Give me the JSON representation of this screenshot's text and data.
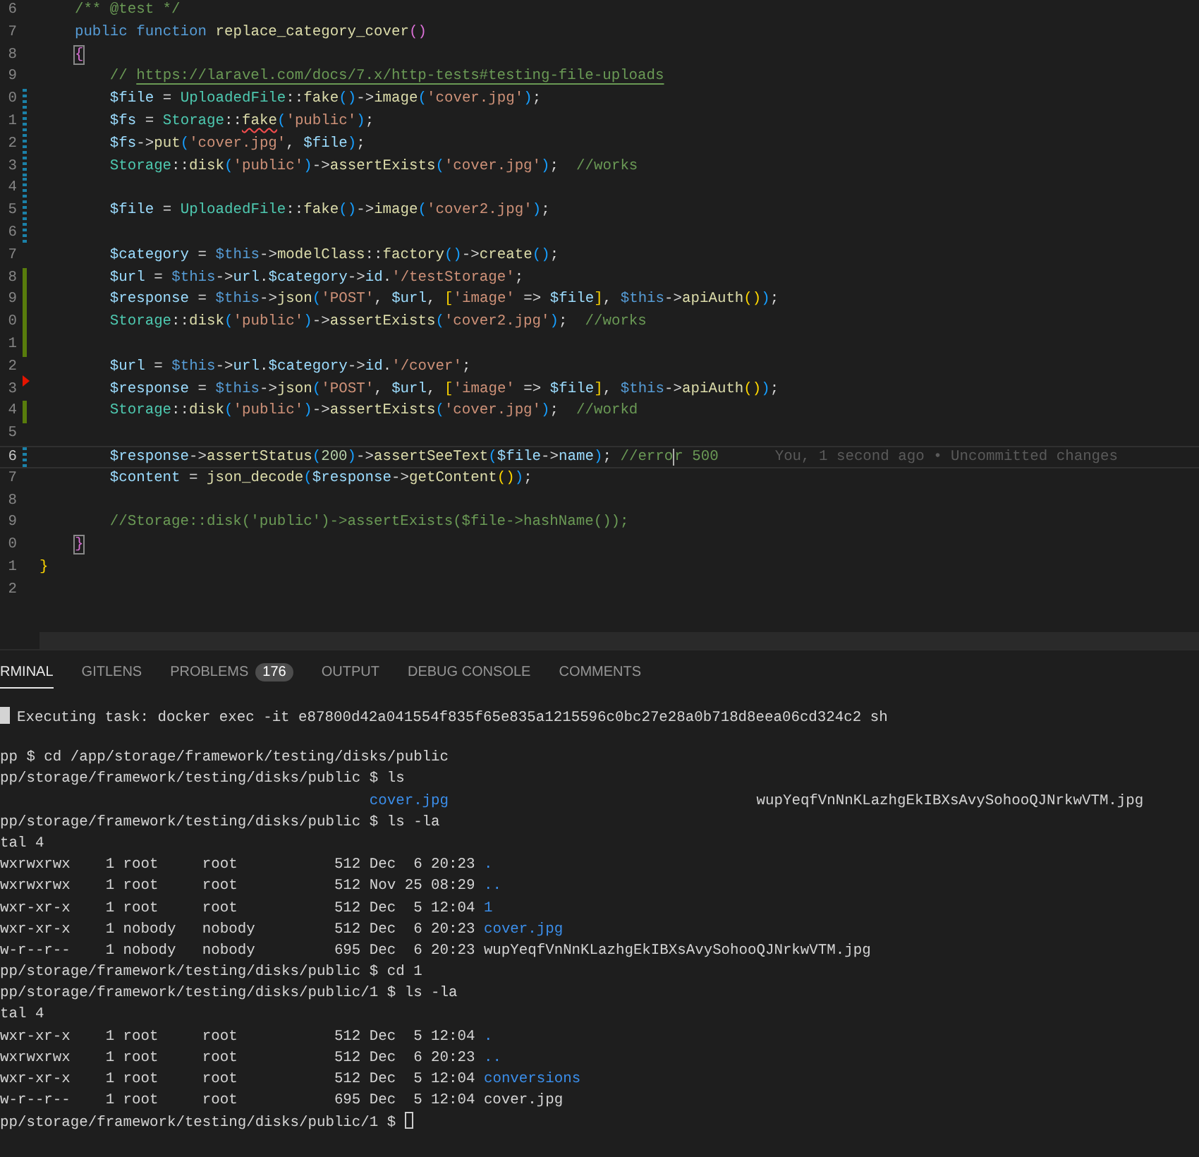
{
  "editor": {
    "lines": [
      {
        "number": "6",
        "kind": "unchanged",
        "current": false,
        "tokens": [
          {
            "kind": "com",
            "text": "    /** @test */"
          }
        ]
      },
      {
        "number": "7",
        "kind": "unchanged",
        "current": false,
        "tokens": [
          {
            "kind": "kw",
            "text": "    public"
          },
          {
            "kind": "kw",
            "text": " function"
          },
          {
            "kind": "fn",
            "text": " replace_category_cover"
          },
          {
            "kind": "br2",
            "text": "()"
          }
        ]
      },
      {
        "number": "8",
        "kind": "unchanged",
        "current": false,
        "tokens": [
          {
            "kind": "br2box",
            "text": "    {"
          }
        ]
      },
      {
        "number": "9",
        "kind": "unchanged",
        "current": false,
        "tokens": [
          {
            "kind": "com",
            "text": "        //"
          },
          {
            "kind": "url",
            "text": " https://laravel.com/docs/7.x/http-tests#testing-file-uploads"
          }
        ]
      },
      {
        "number": "0",
        "kind": "modified",
        "current": false,
        "tokens": [
          {
            "kind": "var",
            "text": "        $file"
          },
          {
            "kind": "txt",
            "text": " ="
          },
          {
            "kind": "cls",
            "text": " UploadedFile"
          },
          {
            "kind": "txt",
            "text": "::"
          },
          {
            "kind": "fn",
            "text": "fake"
          },
          {
            "kind": "br3",
            "text": "()"
          },
          {
            "kind": "txt",
            "text": "->"
          },
          {
            "kind": "fn",
            "text": "image"
          },
          {
            "kind": "br3",
            "text": "("
          },
          {
            "kind": "str",
            "text": "'cover.jpg'"
          },
          {
            "kind": "br3",
            "text": ")"
          },
          {
            "kind": "txt",
            "text": ";"
          }
        ]
      },
      {
        "number": "1",
        "kind": "modified",
        "current": false,
        "tokens": [
          {
            "kind": "var",
            "text": "        $fs"
          },
          {
            "kind": "txt",
            "text": " ="
          },
          {
            "kind": "cls",
            "text": " Storage"
          },
          {
            "kind": "txt",
            "text": "::"
          },
          {
            "kind": "errfn",
            "text": "fake"
          },
          {
            "kind": "br3",
            "text": "("
          },
          {
            "kind": "str",
            "text": "'public'"
          },
          {
            "kind": "br3",
            "text": ")"
          },
          {
            "kind": "txt",
            "text": ";"
          }
        ]
      },
      {
        "number": "2",
        "kind": "modified",
        "current": false,
        "tokens": [
          {
            "kind": "var",
            "text": "        $fs"
          },
          {
            "kind": "txt",
            "text": "->"
          },
          {
            "kind": "fn",
            "text": "put"
          },
          {
            "kind": "br3",
            "text": "("
          },
          {
            "kind": "str",
            "text": "'cover.jpg'"
          },
          {
            "kind": "txt",
            "text": ","
          },
          {
            "kind": "var",
            "text": " $file"
          },
          {
            "kind": "br3",
            "text": ")"
          },
          {
            "kind": "txt",
            "text": ";"
          }
        ]
      },
      {
        "number": "3",
        "kind": "modified",
        "current": false,
        "tokens": [
          {
            "kind": "cls",
            "text": "        Storage"
          },
          {
            "kind": "txt",
            "text": "::"
          },
          {
            "kind": "fn",
            "text": "disk"
          },
          {
            "kind": "br3",
            "text": "("
          },
          {
            "kind": "str",
            "text": "'public'"
          },
          {
            "kind": "br3",
            "text": ")"
          },
          {
            "kind": "txt",
            "text": "->"
          },
          {
            "kind": "fn",
            "text": "assertExists"
          },
          {
            "kind": "br3",
            "text": "("
          },
          {
            "kind": "str",
            "text": "'cover.jpg'"
          },
          {
            "kind": "br3",
            "text": ")"
          },
          {
            "kind": "txt",
            "text": ";"
          },
          {
            "kind": "com",
            "text": "  //works"
          }
        ]
      },
      {
        "number": "4",
        "kind": "modified",
        "current": false
      },
      {
        "number": "5",
        "kind": "modified",
        "current": false,
        "tokens": [
          {
            "kind": "var",
            "text": "        $file"
          },
          {
            "kind": "txt",
            "text": " ="
          },
          {
            "kind": "cls",
            "text": " UploadedFile"
          },
          {
            "kind": "txt",
            "text": "::"
          },
          {
            "kind": "fn",
            "text": "fake"
          },
          {
            "kind": "br3",
            "text": "()"
          },
          {
            "kind": "txt",
            "text": "->"
          },
          {
            "kind": "fn",
            "text": "image"
          },
          {
            "kind": "br3",
            "text": "("
          },
          {
            "kind": "str",
            "text": "'cover2.jpg'"
          },
          {
            "kind": "br3",
            "text": ")"
          },
          {
            "kind": "txt",
            "text": ";"
          }
        ]
      },
      {
        "number": "6",
        "kind": "modified",
        "current": false
      },
      {
        "number": "7",
        "kind": "unchanged",
        "current": false,
        "tokens": [
          {
            "kind": "var",
            "text": "        $category"
          },
          {
            "kind": "txt",
            "text": " ="
          },
          {
            "kind": "kw",
            "text": " $this"
          },
          {
            "kind": "txt",
            "text": "->"
          },
          {
            "kind": "fn",
            "text": "modelClass"
          },
          {
            "kind": "txt",
            "text": "::"
          },
          {
            "kind": "fn",
            "text": "factory"
          },
          {
            "kind": "br3",
            "text": "()"
          },
          {
            "kind": "txt",
            "text": "->"
          },
          {
            "kind": "fn",
            "text": "create"
          },
          {
            "kind": "br3",
            "text": "()"
          },
          {
            "kind": "txt",
            "text": ";"
          }
        ]
      },
      {
        "number": "8",
        "kind": "added",
        "current": false,
        "tokens": [
          {
            "kind": "var",
            "text": "        $url"
          },
          {
            "kind": "txt",
            "text": " ="
          },
          {
            "kind": "kw",
            "text": " $this"
          },
          {
            "kind": "txt",
            "text": "->"
          },
          {
            "kind": "var",
            "text": "url"
          },
          {
            "kind": "txt",
            "text": "."
          },
          {
            "kind": "var",
            "text": "$category"
          },
          {
            "kind": "txt",
            "text": "->"
          },
          {
            "kind": "var",
            "text": "id"
          },
          {
            "kind": "txt",
            "text": "."
          },
          {
            "kind": "str",
            "text": "'/testStorage'"
          },
          {
            "kind": "txt",
            "text": ";"
          }
        ]
      },
      {
        "number": "9",
        "kind": "added",
        "current": false,
        "tokens": [
          {
            "kind": "var",
            "text": "        $response"
          },
          {
            "kind": "txt",
            "text": " ="
          },
          {
            "kind": "kw",
            "text": " $this"
          },
          {
            "kind": "txt",
            "text": "->"
          },
          {
            "kind": "fn",
            "text": "json"
          },
          {
            "kind": "br3",
            "text": "("
          },
          {
            "kind": "str",
            "text": "'POST'"
          },
          {
            "kind": "txt",
            "text": ","
          },
          {
            "kind": "var",
            "text": " $url"
          },
          {
            "kind": "txt",
            "text": ","
          },
          {
            "kind": "br1",
            "text": " ["
          },
          {
            "kind": "str",
            "text": "'image'"
          },
          {
            "kind": "txt",
            "text": " =>"
          },
          {
            "kind": "var",
            "text": " $file"
          },
          {
            "kind": "br1",
            "text": "]"
          },
          {
            "kind": "txt",
            "text": ","
          },
          {
            "kind": "kw",
            "text": " $this"
          },
          {
            "kind": "txt",
            "text": "->"
          },
          {
            "kind": "fn",
            "text": "apiAuth"
          },
          {
            "kind": "br1",
            "text": "()"
          },
          {
            "kind": "br3",
            "text": ")"
          },
          {
            "kind": "txt",
            "text": ";"
          }
        ]
      },
      {
        "number": "0",
        "kind": "added",
        "current": false,
        "tokens": [
          {
            "kind": "cls",
            "text": "        Storage"
          },
          {
            "kind": "txt",
            "text": "::"
          },
          {
            "kind": "fn",
            "text": "disk"
          },
          {
            "kind": "br3",
            "text": "("
          },
          {
            "kind": "str",
            "text": "'public'"
          },
          {
            "kind": "br3",
            "text": ")"
          },
          {
            "kind": "txt",
            "text": "->"
          },
          {
            "kind": "fn",
            "text": "assertExists"
          },
          {
            "kind": "br3",
            "text": "("
          },
          {
            "kind": "str",
            "text": "'cover2.jpg'"
          },
          {
            "kind": "br3",
            "text": ")"
          },
          {
            "kind": "txt",
            "text": ";"
          },
          {
            "kind": "com",
            "text": "  //works"
          }
        ]
      },
      {
        "number": "1",
        "kind": "added",
        "current": false
      },
      {
        "number": "2",
        "kind": "unchanged",
        "current": false,
        "tokens": [
          {
            "kind": "var",
            "text": "        $url"
          },
          {
            "kind": "txt",
            "text": " ="
          },
          {
            "kind": "kw",
            "text": " $this"
          },
          {
            "kind": "txt",
            "text": "->"
          },
          {
            "kind": "var",
            "text": "url"
          },
          {
            "kind": "txt",
            "text": "."
          },
          {
            "kind": "var",
            "text": "$category"
          },
          {
            "kind": "txt",
            "text": "->"
          },
          {
            "kind": "var",
            "text": "id"
          },
          {
            "kind": "txt",
            "text": "."
          },
          {
            "kind": "str",
            "text": "'/cover'"
          },
          {
            "kind": "txt",
            "text": ";"
          }
        ]
      },
      {
        "number": "3",
        "kind": "deleted",
        "current": false,
        "tokens": [
          {
            "kind": "var",
            "text": "        $response"
          },
          {
            "kind": "txt",
            "text": " ="
          },
          {
            "kind": "kw",
            "text": " $this"
          },
          {
            "kind": "txt",
            "text": "->"
          },
          {
            "kind": "fn",
            "text": "json"
          },
          {
            "kind": "br3",
            "text": "("
          },
          {
            "kind": "str",
            "text": "'POST'"
          },
          {
            "kind": "txt",
            "text": ","
          },
          {
            "kind": "var",
            "text": " $url"
          },
          {
            "kind": "txt",
            "text": ","
          },
          {
            "kind": "br1",
            "text": " ["
          },
          {
            "kind": "str",
            "text": "'image'"
          },
          {
            "kind": "txt",
            "text": " =>"
          },
          {
            "kind": "var",
            "text": " $file"
          },
          {
            "kind": "br1",
            "text": "]"
          },
          {
            "kind": "txt",
            "text": ","
          },
          {
            "kind": "kw",
            "text": " $this"
          },
          {
            "kind": "txt",
            "text": "->"
          },
          {
            "kind": "fn",
            "text": "apiAuth"
          },
          {
            "kind": "br1",
            "text": "()"
          },
          {
            "kind": "br3",
            "text": ")"
          },
          {
            "kind": "txt",
            "text": ";"
          }
        ]
      },
      {
        "number": "4",
        "kind": "added",
        "current": false,
        "tokens": [
          {
            "kind": "cls",
            "text": "        Storage"
          },
          {
            "kind": "txt",
            "text": "::"
          },
          {
            "kind": "fn",
            "text": "disk"
          },
          {
            "kind": "br3",
            "text": "("
          },
          {
            "kind": "str",
            "text": "'public'"
          },
          {
            "kind": "br3",
            "text": ")"
          },
          {
            "kind": "txt",
            "text": "->"
          },
          {
            "kind": "fn",
            "text": "assertExists"
          },
          {
            "kind": "br3",
            "text": "("
          },
          {
            "kind": "str",
            "text": "'cover.jpg'"
          },
          {
            "kind": "br3",
            "text": ")"
          },
          {
            "kind": "txt",
            "text": ";"
          },
          {
            "kind": "com",
            "text": "  //workd"
          }
        ]
      },
      {
        "number": "5",
        "kind": "unchanged",
        "current": false
      },
      {
        "number": "6",
        "kind": "modified",
        "current": true,
        "blame": "You, 1 second ago • Uncommitted changes",
        "tokens": [
          {
            "kind": "var",
            "text": "        $response"
          },
          {
            "kind": "txt",
            "text": "->"
          },
          {
            "kind": "fn",
            "text": "assertStatus"
          },
          {
            "kind": "br3",
            "text": "("
          },
          {
            "kind": "num",
            "text": "200"
          },
          {
            "kind": "br3",
            "text": ")"
          },
          {
            "kind": "txt",
            "text": "->"
          },
          {
            "kind": "fn",
            "text": "assertSeeText"
          },
          {
            "kind": "br3",
            "text": "("
          },
          {
            "kind": "var",
            "text": "$file"
          },
          {
            "kind": "txt",
            "text": "->"
          },
          {
            "kind": "var",
            "text": "name"
          },
          {
            "kind": "br3",
            "text": ")"
          },
          {
            "kind": "txt",
            "text": ";"
          },
          {
            "kind": "com",
            "text": " //erro"
          },
          {
            "kind": "comcur",
            "text": "r 500"
          }
        ]
      },
      {
        "number": "7",
        "kind": "unchanged",
        "current": false,
        "tokens": [
          {
            "kind": "var",
            "text": "        $content"
          },
          {
            "kind": "txt",
            "text": " ="
          },
          {
            "kind": "fn",
            "text": " json_decode"
          },
          {
            "kind": "br3",
            "text": "("
          },
          {
            "kind": "var",
            "text": "$response"
          },
          {
            "kind": "txt",
            "text": "->"
          },
          {
            "kind": "fn",
            "text": "getContent"
          },
          {
            "kind": "br1",
            "text": "()"
          },
          {
            "kind": "br3",
            "text": ")"
          },
          {
            "kind": "txt",
            "text": ";"
          }
        ]
      },
      {
        "number": "8",
        "kind": "unchanged",
        "current": false
      },
      {
        "number": "9",
        "kind": "unchanged",
        "current": false,
        "tokens": [
          {
            "kind": "com",
            "text": "        //Storage::disk('public')->assertExists($file->hashName());"
          }
        ]
      },
      {
        "number": "0",
        "kind": "unchanged",
        "current": false,
        "tokens": [
          {
            "kind": "br2box",
            "text": "    }"
          }
        ]
      },
      {
        "number": "1",
        "kind": "unchanged",
        "current": false,
        "tokens": [
          {
            "kind": "br1",
            "text": "}"
          }
        ]
      },
      {
        "number": "2",
        "kind": "unchanged",
        "current": false
      }
    ]
  },
  "panel": {
    "tabs": [
      {
        "label": "RMINAL",
        "selected": true
      },
      {
        "label": "GITLENS",
        "selected": false
      },
      {
        "label": "PROBLEMS",
        "selected": false,
        "badge": "176"
      },
      {
        "label": "OUTPUT",
        "selected": false
      },
      {
        "label": "DEBUG CONSOLE",
        "selected": false
      },
      {
        "label": "COMMENTS",
        "selected": false
      }
    ],
    "terminal": {
      "lines": [
        {
          "kind": "task",
          "tokens": [
            {
              "kind": "txt",
              "text": "Executing task: docker exec -it e87800d42a041554f835f65e835a1215596c0bc27e28a0b718d8eea06cd324c2 sh"
            }
          ]
        },
        {
          "kind": "plain",
          "tokens": [
            {
              "kind": "txt",
              "text": "pp $ cd /app/storage/framework/testing/disks/public"
            }
          ]
        },
        {
          "kind": "plain",
          "tokens": [
            {
              "kind": "txt",
              "text": "pp/storage/framework/testing/disks/public $ ls"
            }
          ]
        },
        {
          "kind": "plain",
          "tokens": [
            {
              "kind": "dir",
              "text": "                                          cover.jpg"
            },
            {
              "kind": "txt",
              "text": "                                   wupYeqfVnNnKLazhgEkIBXsAvySohooQJNrkwVTM.jpg"
            }
          ]
        },
        {
          "kind": "plain",
          "tokens": [
            {
              "kind": "txt",
              "text": "pp/storage/framework/testing/disks/public $ ls -la"
            }
          ]
        },
        {
          "kind": "plain",
          "tokens": [
            {
              "kind": "txt",
              "text": "tal 4"
            }
          ]
        },
        {
          "kind": "plain",
          "tokens": [
            {
              "kind": "txt",
              "text": "wxrwxrwx    1 root     root           512 Dec  6 20:23"
            },
            {
              "kind": "dir",
              "text": " ."
            }
          ]
        },
        {
          "kind": "plain",
          "tokens": [
            {
              "kind": "txt",
              "text": "wxrwxrwx    1 root     root           512 Nov 25 08:29"
            },
            {
              "kind": "dir",
              "text": " .."
            }
          ]
        },
        {
          "kind": "plain",
          "tokens": [
            {
              "kind": "txt",
              "text": "wxr-xr-x    1 root     root           512 Dec  5 12:04"
            },
            {
              "kind": "dir",
              "text": " 1"
            }
          ]
        },
        {
          "kind": "plain",
          "tokens": [
            {
              "kind": "txt",
              "text": "wxr-xr-x    1 nobody   nobody         512 Dec  6 20:23"
            },
            {
              "kind": "dir",
              "text": " cover.jpg"
            }
          ]
        },
        {
          "kind": "plain",
          "tokens": [
            {
              "kind": "txt",
              "text": "w-r--r--    1 nobody   nobody         695 Dec  6 20:23 wupYeqfVnNnKLazhgEkIBXsAvySohooQJNrkwVTM.jpg"
            }
          ]
        },
        {
          "kind": "plain",
          "tokens": [
            {
              "kind": "txt",
              "text": "pp/storage/framework/testing/disks/public $ cd 1"
            }
          ]
        },
        {
          "kind": "plain",
          "tokens": [
            {
              "kind": "txt",
              "text": "pp/storage/framework/testing/disks/public/1 $ ls -la"
            }
          ]
        },
        {
          "kind": "plain",
          "tokens": [
            {
              "kind": "txt",
              "text": "tal 4"
            }
          ]
        },
        {
          "kind": "plain",
          "tokens": [
            {
              "kind": "txt",
              "text": "wxr-xr-x    1 root     root           512 Dec  5 12:04"
            },
            {
              "kind": "dir",
              "text": " ."
            }
          ]
        },
        {
          "kind": "plain",
          "tokens": [
            {
              "kind": "txt",
              "text": "wxrwxrwx    1 root     root           512 Dec  6 20:23"
            },
            {
              "kind": "dir",
              "text": " .."
            }
          ]
        },
        {
          "kind": "plain",
          "tokens": [
            {
              "kind": "txt",
              "text": "wxr-xr-x    1 root     root           512 Dec  5 12:04"
            },
            {
              "kind": "dir",
              "text": " conversions"
            }
          ]
        },
        {
          "kind": "plain",
          "tokens": [
            {
              "kind": "txt",
              "text": "w-r--r--    1 root     root           695 Dec  5 12:04 cover.jpg"
            }
          ]
        },
        {
          "kind": "active",
          "tokens": [
            {
              "kind": "txt",
              "text": "pp/storage/framework/testing/disks/public/1 $"
            }
          ]
        }
      ]
    }
  }
}
